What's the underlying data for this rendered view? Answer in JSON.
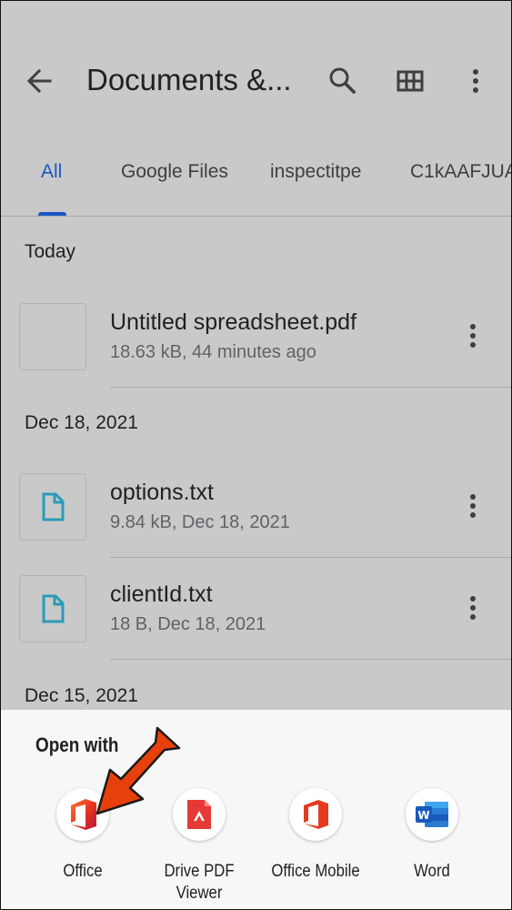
{
  "appbar": {
    "title": "Documents &...",
    "back_icon": "arrow-left-icon",
    "search_icon": "search-icon",
    "grid_icon": "grid-view-icon",
    "more_icon": "more-vert-icon"
  },
  "tabs": [
    {
      "label": "All",
      "active": true
    },
    {
      "label": "Google Files",
      "active": false
    },
    {
      "label": "inspectitpe",
      "active": false
    },
    {
      "label": "C1kAAFJUA",
      "active": false
    }
  ],
  "sections": [
    {
      "header": "Today",
      "files": [
        {
          "name": "Untitled spreadsheet.pdf",
          "meta": "18.63 kB, 44 minutes ago",
          "icon": "blank-thumbnail"
        }
      ]
    },
    {
      "header": "Dec 18, 2021",
      "files": [
        {
          "name": "options.txt",
          "meta": "9.84 kB, Dec 18, 2021",
          "icon": "document-icon"
        },
        {
          "name": "clientId.txt",
          "meta": "18 B, Dec 18, 2021",
          "icon": "document-icon"
        }
      ]
    },
    {
      "header": "Dec 15, 2021",
      "files": []
    }
  ],
  "open_with": {
    "title": "Open with",
    "apps": [
      {
        "label": "Office",
        "icon": "office-icon"
      },
      {
        "label": "Drive PDF Viewer",
        "icon": "drive-pdf-viewer-icon"
      },
      {
        "label": "Office Mobile",
        "icon": "office-mobile-icon"
      },
      {
        "label": "Word",
        "icon": "word-icon"
      }
    ],
    "highlight_arrow_color": "#e8400c"
  },
  "colors": {
    "accent": "#1a56c4",
    "doc_icon": "#2a9bb7",
    "overlay_bg": "#c9c9c9",
    "sheet_bg": "#f7f7f7"
  }
}
